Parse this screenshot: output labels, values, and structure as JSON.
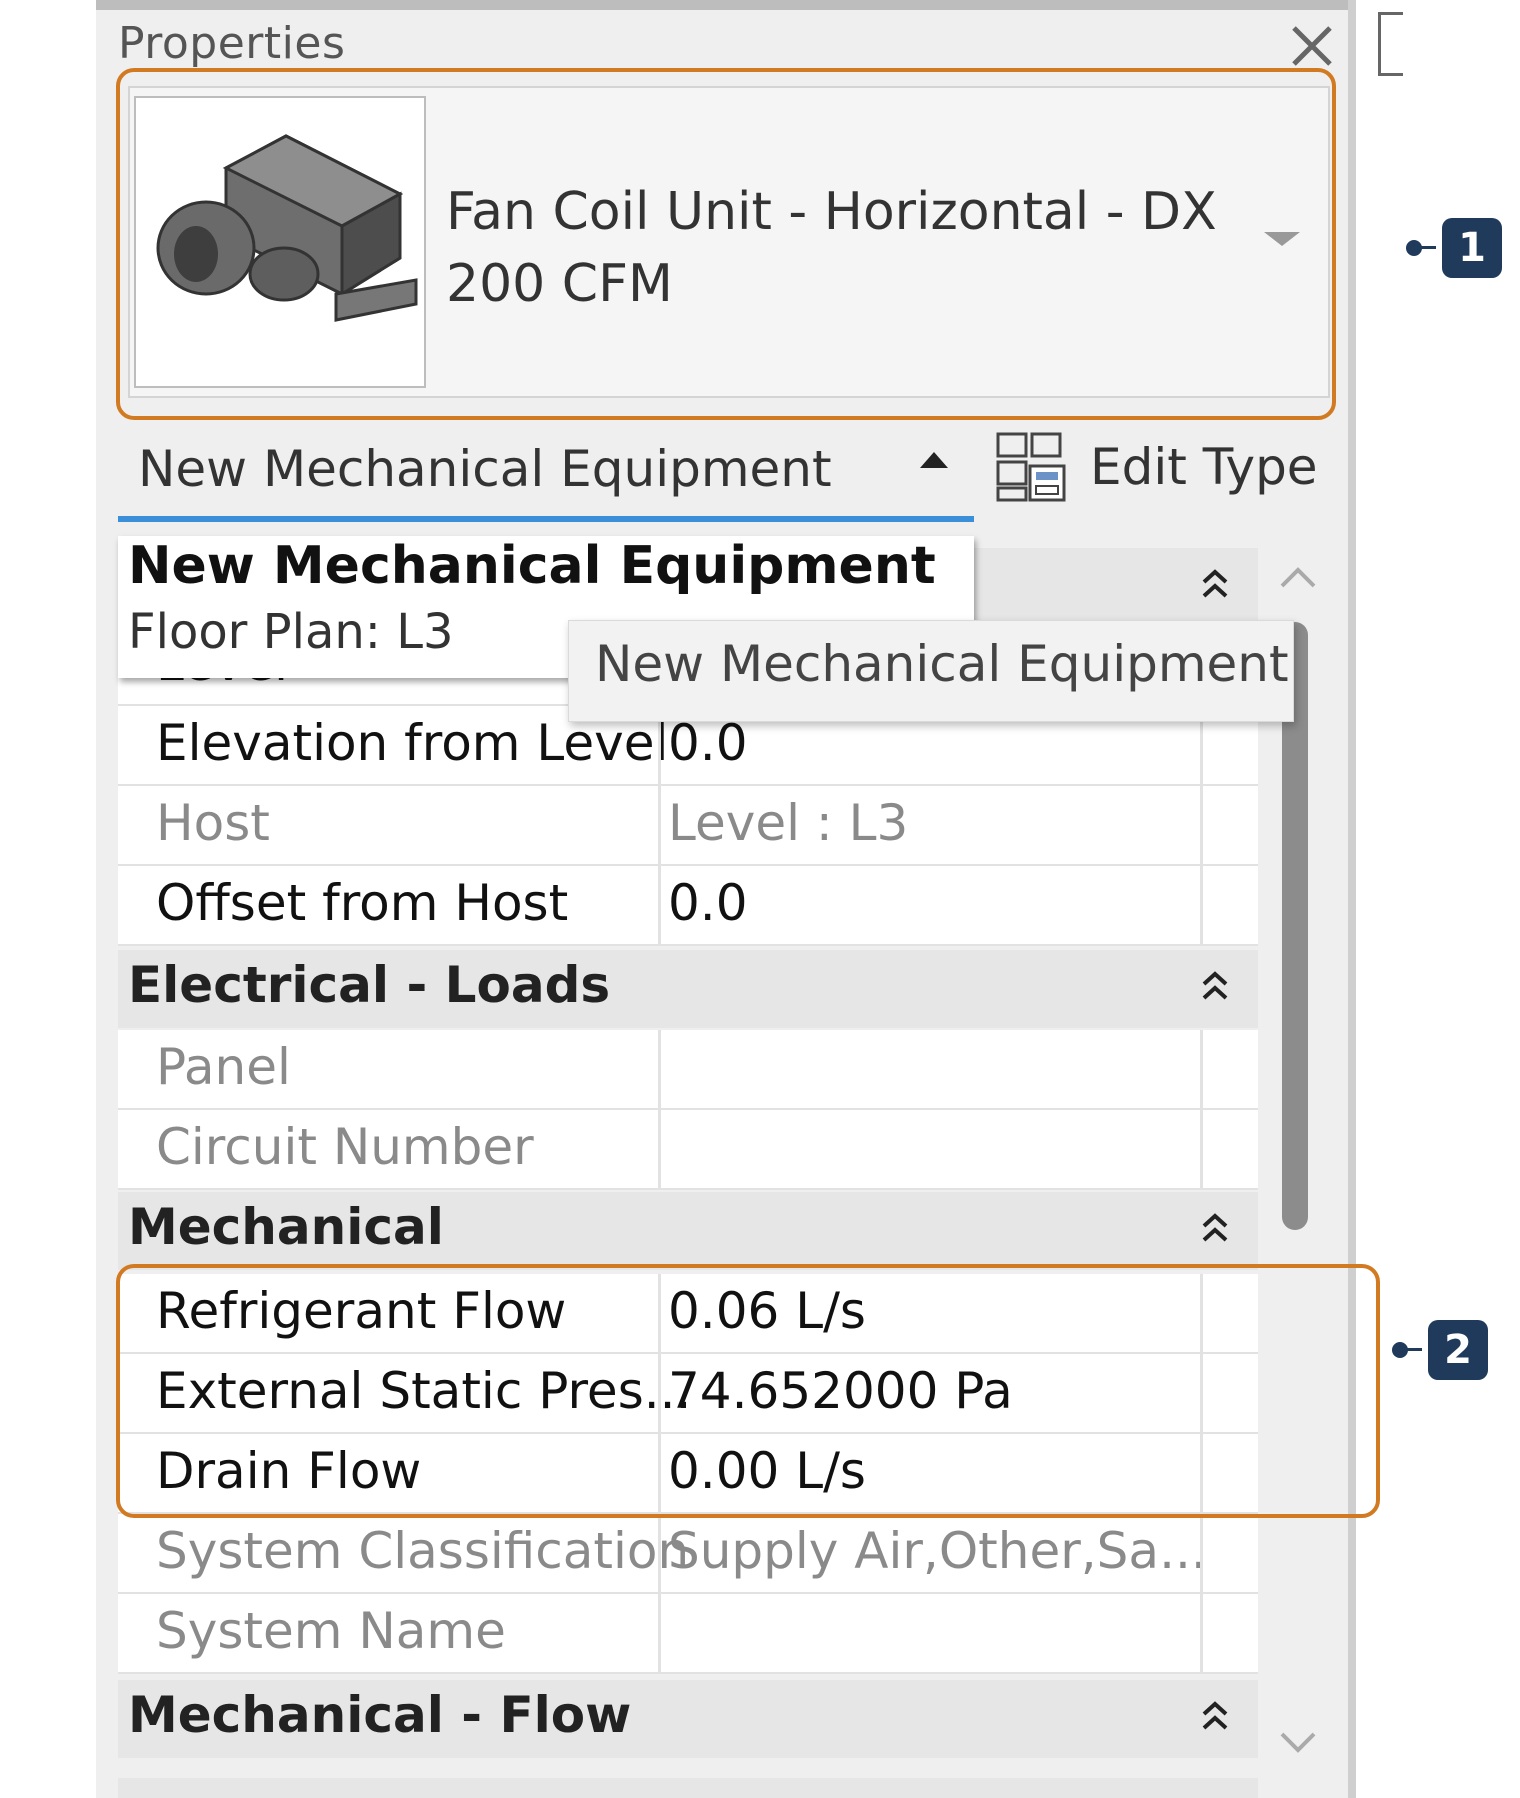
{
  "panel": {
    "title": "Properties"
  },
  "type_selector": {
    "line1": "Fan Coil Unit - Horizontal - DX",
    "line2": "200 CFM"
  },
  "filter": {
    "label": "New Mechanical Equipment",
    "edit_type": "Edit Type"
  },
  "popup": {
    "title": "New Mechanical Equipment",
    "view": "Floor Plan: L3"
  },
  "tooltip": "New Mechanical Equipment",
  "rows_constraints": [
    {
      "label": "Elevation from Level",
      "value": "0.0"
    },
    {
      "label": "Host",
      "value": "Level : L3"
    },
    {
      "label": "Offset from Host",
      "value": "0.0"
    }
  ],
  "groups": {
    "electrical_loads": "Electrical - Loads",
    "mechanical": "Mechanical",
    "mechanical_flow": "Mechanical - Flow"
  },
  "rows_electrical": [
    {
      "label": "Panel",
      "value": ""
    },
    {
      "label": "Circuit Number",
      "value": ""
    }
  ],
  "rows_mechanical": [
    {
      "label": "Refrigerant Flow",
      "value": "0.06 L/s"
    },
    {
      "label": "External Static Pres...",
      "value": "74.652000 Pa"
    },
    {
      "label": "Drain Flow",
      "value": "0.00 L/s"
    },
    {
      "label": "System Classification",
      "value": "Supply Air,Other,Sa..."
    },
    {
      "label": "System Name",
      "value": ""
    }
  ],
  "callouts": [
    "1",
    "2"
  ],
  "colors": {
    "highlight": "#d17a22",
    "badge": "#1f3a5a",
    "tab_underline": "#3b8ed8"
  },
  "icons": [
    "close-icon",
    "fan-coil-unit-thumbnail",
    "chevron-down-icon",
    "caret-up-icon",
    "edit-type-icon",
    "collapse-double-chevron-icon",
    "scroll-up-icon",
    "scroll-down-icon"
  ]
}
